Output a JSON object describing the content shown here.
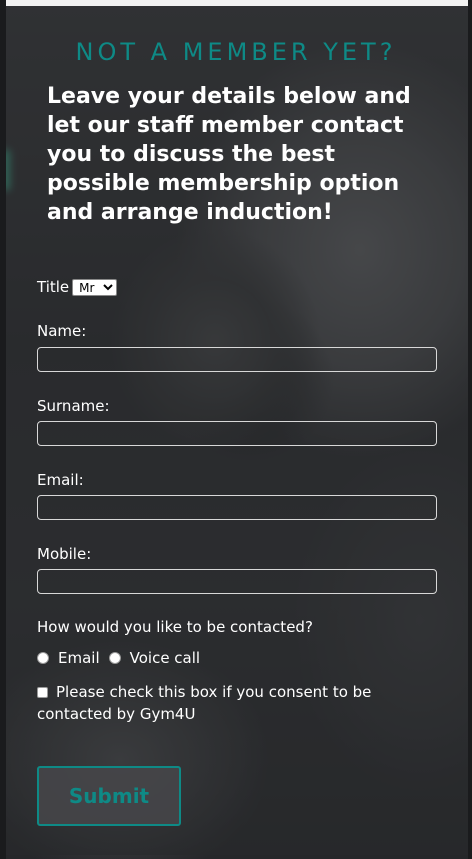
{
  "heading": "NOT A MEMBER YET?",
  "intro": "Leave your details below and let our staff member contact you to discuss the best possible membership option and arrange induction!",
  "form": {
    "title_label": "Title",
    "title_selected": "Mr",
    "name_label": "Name:",
    "surname_label": "Surname:",
    "email_label": "Email:",
    "mobile_label": "Mobile:",
    "name_value": "",
    "surname_value": "",
    "email_value": "",
    "mobile_value": "",
    "contact_question": "How would you like to be contacted?",
    "contact_options": [
      "Email",
      "Voice call"
    ],
    "consent_text": "Please check this box if you consent to be contacted by Gym4U",
    "submit_label": "Submit"
  },
  "colors": {
    "accent": "#0e8a86",
    "text": "#ffffff",
    "panel": "#2a2b2d"
  }
}
